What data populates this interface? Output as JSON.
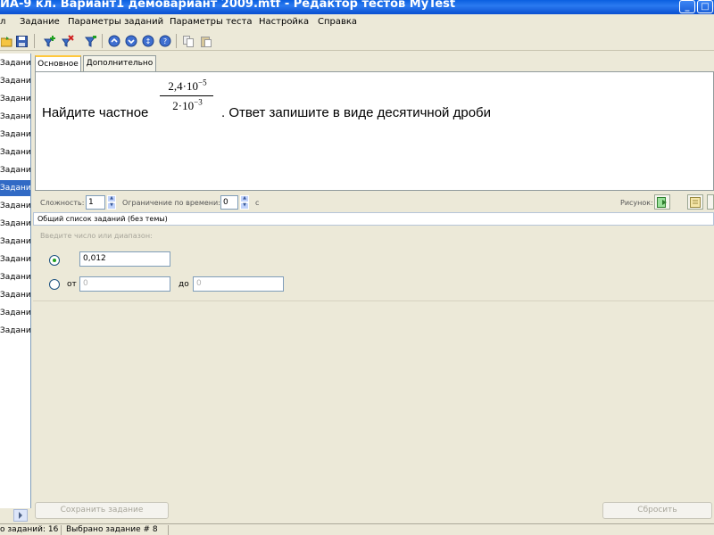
{
  "window": {
    "title": "ИА-9 кл. Вариант1 демовариант 2009.mtf - Редактор тестов MyTest"
  },
  "menu": {
    "items": [
      "л",
      "Задание",
      "Параметры заданий",
      "Параметры теста",
      "Настройка",
      "Справка"
    ]
  },
  "toolbar": {
    "icons": [
      "open-icon",
      "save-icon",
      "add-task-icon",
      "delete-task-icon",
      "filter-icon",
      "move-up-icon",
      "move-down-icon",
      "move-icon",
      "help-icon",
      "copy-icon",
      "paste-icon"
    ]
  },
  "task_list": {
    "items": [
      "Задание",
      "Задание",
      "Задание",
      "Задание",
      "Задание",
      "Задание",
      "Задание",
      "Задание",
      "Задание",
      "Задание",
      "Задание",
      "Задание",
      "Задание",
      "Задание",
      "Задание",
      "Задание"
    ],
    "selected_index": 7
  },
  "tabs": [
    "Основное",
    "Дополнительно"
  ],
  "question": {
    "prefix": "Найдите частное",
    "numerator_base": "2,4·10",
    "numerator_exp": "−5",
    "denominator_base": "2·10",
    "denominator_exp": "−3",
    "suffix": ". Ответ запишите в виде десятичной дроби"
  },
  "properties": {
    "difficulty_label": "Сложность:",
    "difficulty_value": "1",
    "time_limit_label": "Ограничение по времени:",
    "time_limit_value": "0",
    "time_unit": "с",
    "picture_label": "Рисунок:"
  },
  "theme": {
    "selected": "Общий список заданий (без темы)"
  },
  "answer": {
    "hint": "Введите число или диапазон:",
    "exact_value": "0,012",
    "range_from_label": "от",
    "range_from_value": "0",
    "range_to_label": "до",
    "range_to_value": "0",
    "selected_mode": "exact"
  },
  "buttons": {
    "save": "Сохранить задание",
    "reset": "Сбросить"
  },
  "status": {
    "total": "о заданий: 16",
    "selected": "Выбрано задание # 8"
  }
}
